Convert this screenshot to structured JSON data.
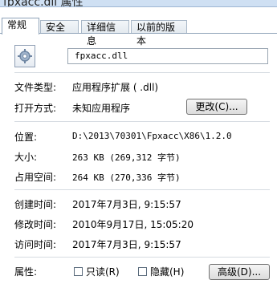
{
  "window": {
    "title": "fpxacc.dll 属性"
  },
  "tabs": [
    {
      "label": "常规"
    },
    {
      "label": "安全"
    },
    {
      "label": "详细信息"
    },
    {
      "label": "以前的版本"
    }
  ],
  "file": {
    "name": "fpxacc.dll",
    "icon": "dll-gear-icon"
  },
  "rows": {
    "file_type": {
      "label": "文件类型:",
      "value": "应用程序扩展 ( .dll)"
    },
    "open_with": {
      "label": "打开方式:",
      "value": "未知应用程序",
      "button": "更改(C)..."
    },
    "location": {
      "label": "位置:",
      "value": "D:\\2013\\70301\\Fpxacc\\X86\\1.2.0"
    },
    "size": {
      "label": "大小:",
      "value": "263 KB (269,312 字节)"
    },
    "size_on_disk": {
      "label": "占用空间:",
      "value": "264 KB (270,336 字节)"
    },
    "created": {
      "label": "创建时间:",
      "value": "2017年7月3日, 9:15:57"
    },
    "modified": {
      "label": "修改时间:",
      "value": "2010年9月17日, 15:05:20"
    },
    "accessed": {
      "label": "访问时间:",
      "value": "2017年7月3日, 9:15:57"
    },
    "attributes": {
      "label": "属性:",
      "readonly": "只读(R)",
      "hidden": "隐藏(H)",
      "advanced": "高级(D)..."
    }
  }
}
